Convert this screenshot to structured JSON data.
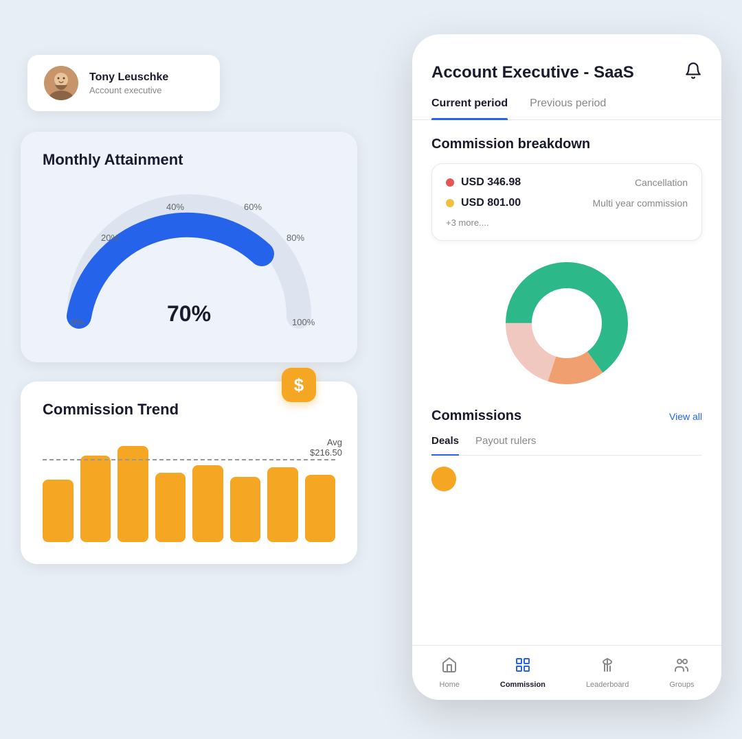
{
  "user": {
    "name": "Tony Leuschke",
    "role": "Account executive"
  },
  "attainment": {
    "title": "Monthly Attainment",
    "value": "70%",
    "labels": {
      "p0": "0%",
      "p20": "20%",
      "p40": "40%",
      "p60": "60%",
      "p80": "80%",
      "p100": "100%"
    }
  },
  "trend": {
    "title": "Commission Trend",
    "avg_label": "Avg",
    "avg_value": "$216.50",
    "dollar_icon": "$",
    "bars": [
      65,
      90,
      100,
      72,
      80,
      68,
      78,
      70
    ]
  },
  "phone": {
    "title": "Account Executive - SaaS",
    "bell_icon": "🔔",
    "tabs": [
      {
        "label": "Current period",
        "active": true
      },
      {
        "label": "Previous period",
        "active": false
      }
    ],
    "breakdown": {
      "section_title": "Commission breakdown",
      "items": [
        {
          "dot_color": "red",
          "amount": "USD 346.98",
          "label": "Cancellation"
        },
        {
          "dot_color": "yellow",
          "amount": "USD 801.00",
          "label": "Multi year commission"
        }
      ],
      "more_text": "+3 more...."
    },
    "donut": {
      "segments": [
        {
          "color": "#2db88a",
          "pct": 65
        },
        {
          "color": "#f0a070",
          "pct": 15
        },
        {
          "color": "#f0c8c8",
          "pct": 20
        }
      ]
    },
    "commissions": {
      "title": "Commissions",
      "view_all": "View all",
      "sub_tabs": [
        {
          "label": "Deals",
          "active": true
        },
        {
          "label": "Payout rulers",
          "active": false
        }
      ]
    },
    "nav": [
      {
        "icon": "🏠",
        "label": "Home",
        "active": false
      },
      {
        "icon": "⊞",
        "label": "Commission",
        "active": true
      },
      {
        "icon": "🏆",
        "label": "Leaderboard",
        "active": false
      },
      {
        "icon": "👥",
        "label": "Groups",
        "active": false
      }
    ]
  }
}
